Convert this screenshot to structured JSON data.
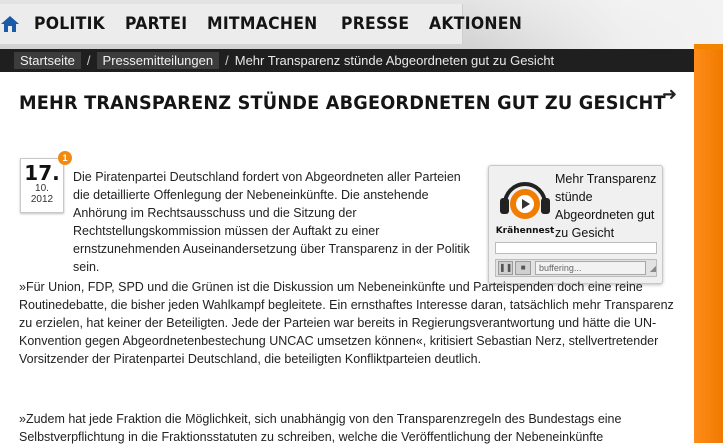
{
  "nav": {
    "items": [
      {
        "label": "POLITIK"
      },
      {
        "label": "PARTEI"
      },
      {
        "label": "MITMACHEN"
      },
      {
        "label": "PRESSE"
      },
      {
        "label": "AKTIONEN"
      }
    ]
  },
  "breadcrumb": {
    "home": "Startseite",
    "section": "Pressemitteilungen",
    "current": "Mehr Transparenz stünde Abgeordneten gut zu Gesicht"
  },
  "article": {
    "title": "MEHR TRANSPARENZ STÜNDE ABGEORDNETEN GUT ZU GESICHT",
    "date": {
      "day": "17.",
      "month": "10.",
      "year": "2012"
    },
    "comment_count": "1",
    "paragraphs": [
      "Die Piratenpartei Deutschland fordert von Abgeordneten aller Parteien die detaillierte Offenlegung der Nebeneinkünfte. Die anstehende Anhörung im Rechtsausschuss und die Sitzung der Rechtstellungskommission müssen der Auftakt zu einer ernstzunehmenden Auseinandersetzung über Transparenz in der Politik sein.",
      "»Für Union, FDP, SPD und die Grünen ist die Diskussion um Nebeneinkünfte und Parteispenden doch eine reine Routinedebatte, die bisher jeden Wahlkampf begleitete. Ein ernsthaftes Interesse daran, tatsächlich mehr Transparenz zu erzielen, hat keiner der Beteiligten. Jede der Parteien war bereits in Regierungsverantwortung und hätte die UN-Konvention gegen Abgeordnetenbestechung UNCAC umsetzen können«, kritisiert Sebastian Nerz, stellvertretender Vorsitzender der Piratenpartei Deutschland, die beteiligten Konfliktparteien deutlich.",
      "»Zudem hat jede Fraktion die Möglichkeit, sich unabhängig von den Transparenzregeln des Bundestags eine Selbstverpflichtung in die Fraktionsstatuten zu schreiben, welche die Veröffentlichung der Nebeneinkünfte"
    ]
  },
  "player": {
    "title": "Mehr Transparenz stünde Abgeordneten gut zu Gesicht",
    "logo_text": "Krähennest",
    "status": "buffering..."
  },
  "colors": {
    "accent": "#f28500",
    "crumbbar": "#1f1f1f"
  },
  "icons": [
    "home-icon",
    "arrow-right-icon",
    "krähennest-logo",
    "pause-icon",
    "stop-icon"
  ]
}
